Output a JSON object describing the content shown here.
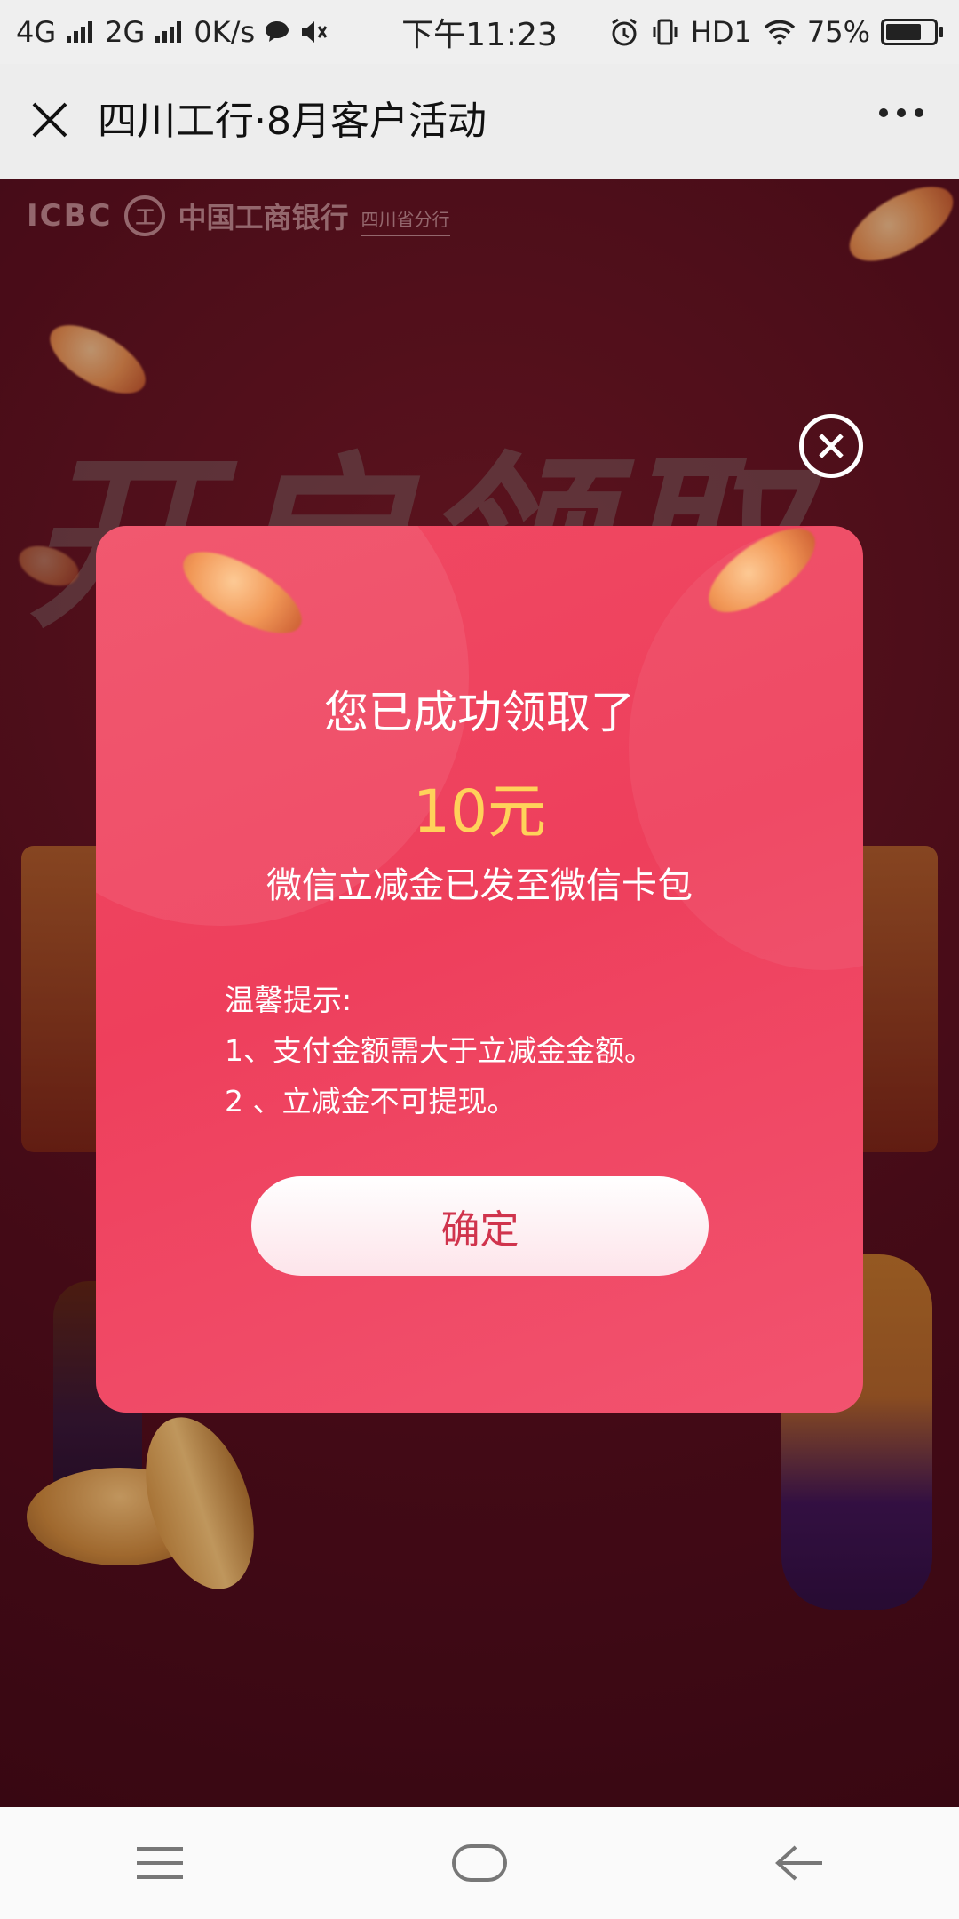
{
  "status_bar": {
    "network_1": "4G",
    "network_2": "2G",
    "speed": "0K/s",
    "time": "下午11:23",
    "hd": "HD1",
    "battery_percent": "75%",
    "battery_level": 0.75
  },
  "header": {
    "title": "四川工行·8月客户活动",
    "close_icon": "close-icon",
    "more_icon": "more-dots-icon"
  },
  "background": {
    "brand_latin": "ICBC",
    "brand_emblem": "工",
    "brand_cn": "中国工商银行",
    "brand_sub": "四川省分行",
    "headline": "开启领取"
  },
  "modal": {
    "title": "您已成功领取了",
    "amount": "10元",
    "subtitle": "微信立减金已发至微信卡包",
    "tips_heading": "温馨提示:",
    "tips": [
      "1、支付金额需大于立减金金额。",
      "2 、立减金不可提现。"
    ],
    "confirm_label": "确定",
    "colors": {
      "accent": "#ee3f5c",
      "amount": "#ffd25a",
      "button_text": "#d0344d"
    }
  },
  "nav": {
    "menu_icon": "menu-icon",
    "home_icon": "home-icon",
    "back_icon": "back-icon"
  }
}
